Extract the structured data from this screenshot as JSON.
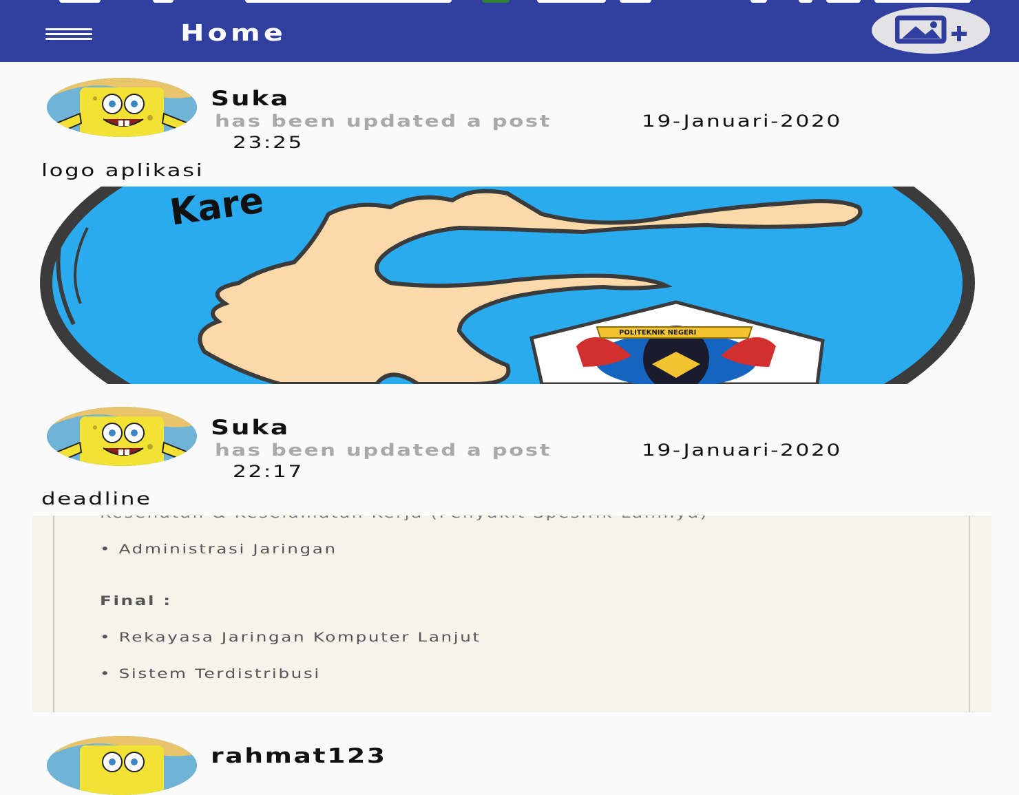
{
  "appbar": {
    "title": "Home",
    "background": "#303f9f"
  },
  "icons": {
    "menu": "hamburger-menu-icon",
    "add_image": "add-photo-icon"
  },
  "posts": [
    {
      "username": "Suka",
      "action": "has been updated a post",
      "date": "19-Januari-2020",
      "time": "23:25",
      "caption": "logo aplikasi",
      "image_logo_text": "POLITEKNIK NEGERI"
    },
    {
      "username": "Suka",
      "action": "has been updated a post",
      "date": "19-Januari-2020",
      "time": "22:17",
      "caption": "deadline",
      "document": {
        "cut_line": "Kesehatan & Keselamatan Kerja (Penyakit Spesifik Lainnya)",
        "items": [
          "• Administrasi Jaringan",
          "Final :",
          "• Rekayasa Jaringan Komputer Lanjut",
          "• Sistem Terdistribusi"
        ]
      }
    },
    {
      "username": "rahmat123"
    }
  ]
}
